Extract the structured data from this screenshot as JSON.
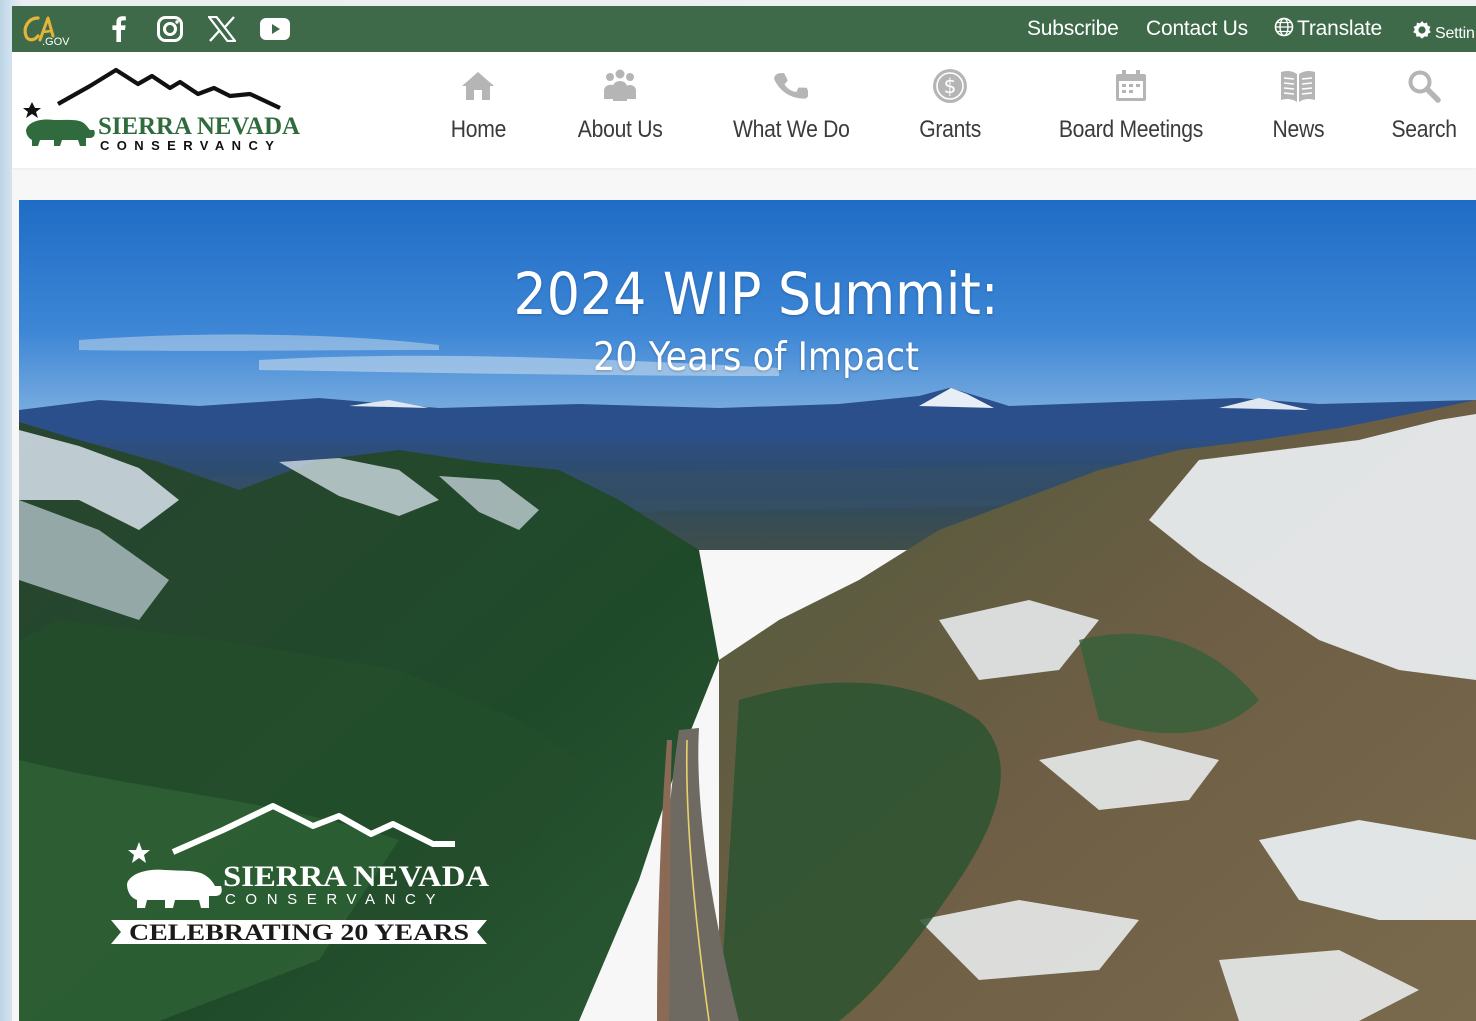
{
  "utility": {
    "social": [
      "facebook-icon",
      "instagram-icon",
      "x-icon",
      "youtube-icon"
    ],
    "links": {
      "subscribe": "Subscribe",
      "contact": "Contact Us",
      "translate": "Translate",
      "settings": "Settin"
    },
    "ca_gov_logo": ".GOV"
  },
  "logo": {
    "name": "SIERRA NEVADA",
    "tagline": "CONSERVANCY"
  },
  "nav": [
    {
      "label": "Home",
      "icon": "home-icon"
    },
    {
      "label": "About Us",
      "icon": "people-icon"
    },
    {
      "label": "What We Do",
      "icon": "phone-icon"
    },
    {
      "label": "Grants",
      "icon": "dollar-icon"
    },
    {
      "label": "Board Meetings",
      "icon": "calendar-icon"
    },
    {
      "label": "News",
      "icon": "newspaper-icon"
    },
    {
      "label": "Search",
      "icon": "search-icon"
    }
  ],
  "hero": {
    "title": "2024 WIP Summit:",
    "subtitle": "20 Years of Impact",
    "badge_name": "SIERRA NEVADA",
    "badge_tagline": "CONSERVANCY",
    "badge_ribbon": "CELEBRATING 20 YEARS"
  },
  "colors": {
    "utility_bar": "#3e6a4a",
    "brand_green": "#2f6b3c",
    "nav_icon": "#b5b5b5",
    "nav_text": "#3b3b3b"
  }
}
